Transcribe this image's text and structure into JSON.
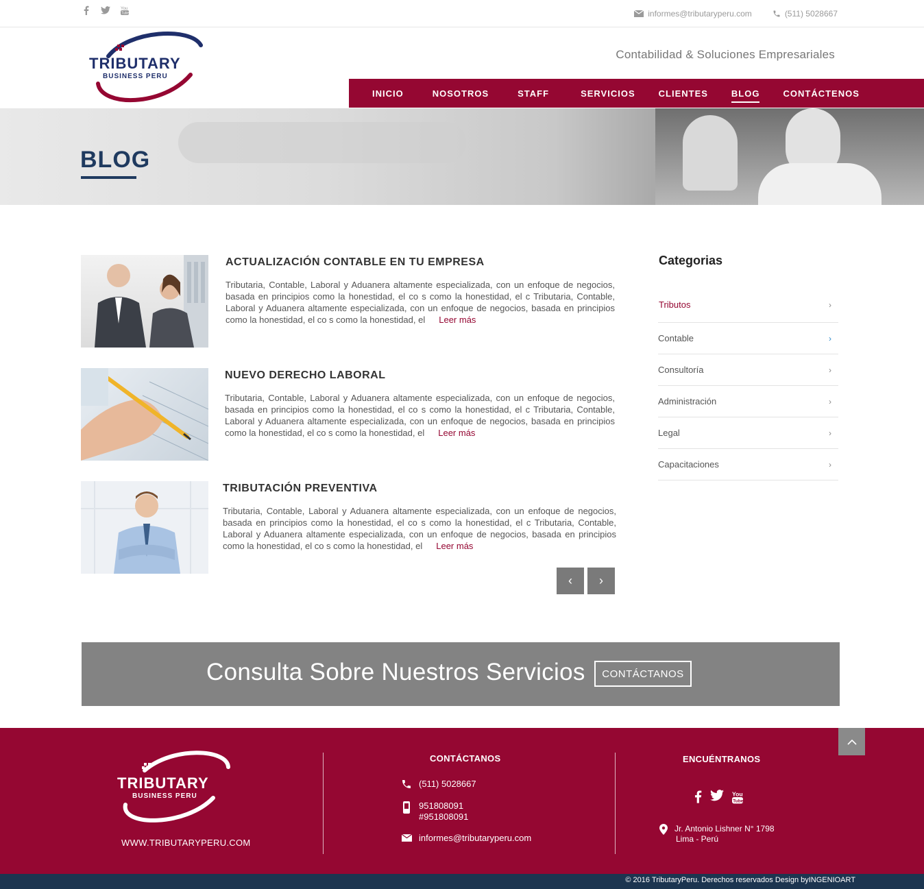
{
  "topbar": {
    "social": [
      {
        "name": "facebook",
        "glyph": "f"
      },
      {
        "name": "twitter",
        "glyph": "🐦"
      },
      {
        "name": "youtube",
        "glyph": "▶"
      }
    ],
    "email": "informes@tributaryperu.com",
    "phone": "(511) 5028667"
  },
  "header": {
    "logo_text_top": "TRIBUTARY",
    "logo_text_bottom": "BUSINESS PERU",
    "tagline": "Contabilidad & Soluciones Empresariales",
    "nav": [
      {
        "label": "INICIO"
      },
      {
        "label": "NOSOTROS"
      },
      {
        "label": "STAFF"
      },
      {
        "label": "SERVICIOS"
      },
      {
        "label": "CLIENTES"
      },
      {
        "label": "BLOG"
      },
      {
        "label": "CONTÁCTENOS"
      }
    ],
    "active_nav": "BLOG"
  },
  "banner": {
    "title": "BLOG"
  },
  "posts": [
    {
      "title": "ACTUALIZACIÓN CONTABLE EN TU EMPRESA",
      "excerpt": "Tributaria, Contable, Laboral y Aduanera altamente especializada, con un enfoque de negocios, basada en principios como la honestidad, el co  s como la honestidad, el c    Tributaria, Contable, Laboral y Aduanera altamente especializada, con un enfoque de negocios, basada en principios como la honestidad, el co  s como la honestidad, el",
      "read_more": "Leer más"
    },
    {
      "title": "NUEVO DERECHO LABORAL",
      "excerpt": "Tributaria, Contable, Laboral y Aduanera altamente especializada, con un enfoque de negocios, basada en principios como la honestidad, el co  s como la honestidad, el c    Tributaria, Contable, Laboral y Aduanera altamente especializada, con un enfoque de negocios, basada en principios como la honestidad, el co  s como la honestidad, el",
      "read_more": "Leer más"
    },
    {
      "title": "TRIBUTACIÓN  PREVENTIVA",
      "excerpt": "Tributaria, Contable, Laboral y Aduanera altamente especializada, con un enfoque de negocios, basada en principios como la honestidad, el co  s como la honestidad, el c    Tributaria, Contable, Laboral y Aduanera altamente especializada, con un enfoque de negocios, basada en principios como la honestidad, el co  s como la honestidad, el",
      "read_more": "Leer más"
    }
  ],
  "pager": {
    "prev": "‹",
    "next": "›"
  },
  "sidebar": {
    "title": "Categorias",
    "categories": [
      {
        "label": "Tributos"
      },
      {
        "label": "Contable"
      },
      {
        "label": "Consultoría"
      },
      {
        "label": "Administración"
      },
      {
        "label": "Legal"
      },
      {
        "label": "Capacitaciones"
      }
    ]
  },
  "cta": {
    "text": "Consulta Sobre Nuestros Servicios",
    "button": "CONTÁCTANOS"
  },
  "footer": {
    "website": "WWW.TRIBUTARYPERU.COM",
    "contact_title": "CONTÁCTANOS",
    "phone": "(511) 5028667",
    "mobile1": "951808091",
    "mobile2": "#951808091",
    "email": "informes@tributaryperu.com",
    "find_title": "ENCUÉNTRANOS",
    "address1": "Jr. Antonio Lishner N° 1798",
    "address2": "Lima - Perú"
  },
  "copyright": "© 2016  TributaryPeru. Derechos reservados Design byINGENIOART",
  "colors": {
    "brand": "#950732",
    "navy": "#1f3a5f",
    "cta_gray": "#838383"
  }
}
